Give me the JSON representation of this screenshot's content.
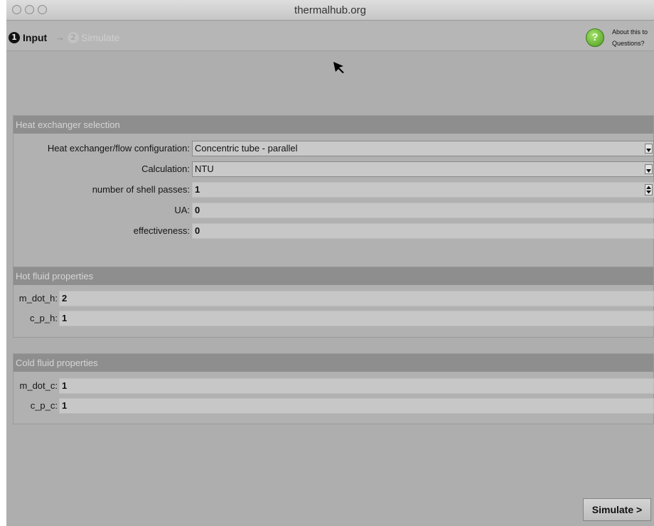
{
  "window": {
    "title": "thermalhub.org"
  },
  "steps": {
    "step1": {
      "number": "1",
      "label": "Input"
    },
    "arrow": "→",
    "step2": {
      "number": "2",
      "label": "Simulate"
    }
  },
  "help": {
    "about": "About this to",
    "questions": "Questions?"
  },
  "heat_exchanger": {
    "header": "Heat exchanger selection",
    "config_label": "Heat exchanger/flow configuration:",
    "config_value": "Concentric tube - parallel",
    "calc_label": "Calculation:",
    "calc_value": "NTU",
    "shell_label": "number of shell passes:",
    "shell_value": "1",
    "ua_label": "UA:",
    "ua_value": "0",
    "eff_label": "effectiveness:",
    "eff_value": "0"
  },
  "hot_fluid": {
    "header": "Hot fluid properties",
    "mdot_label": "m_dot_h:",
    "mdot_value": "2",
    "cp_label": "c_p_h:",
    "cp_value": "1"
  },
  "cold_fluid": {
    "header": "Cold fluid properties",
    "mdot_label": "m_dot_c:",
    "mdot_value": "1",
    "cp_label": "c_p_c:",
    "cp_value": "1"
  },
  "actions": {
    "simulate": "Simulate >"
  },
  "colors": {
    "help_icon": "#5aaa28",
    "panel_header": "#8e8e8e",
    "background": "#aeaeae"
  }
}
